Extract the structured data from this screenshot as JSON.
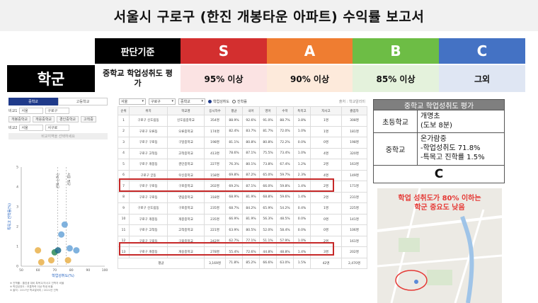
{
  "title": "서울시 구로구 (한진 개봉타운 아파트) 수익률 보고서",
  "criteria": {
    "header_label": "판단기준",
    "grades": [
      {
        "label": "S",
        "color": "#d32f2f",
        "value": "95% 이상",
        "value_bg": "#fbe3e3"
      },
      {
        "label": "A",
        "color": "#ef7d31",
        "value": "90% 이상",
        "value_bg": "#fdeadb"
      },
      {
        "label": "B",
        "color": "#6dbd45",
        "value": "85% 이상",
        "value_bg": "#e4f2dc"
      },
      {
        "label": "C",
        "color": "#4472c4",
        "value": "그외",
        "value_bg": "#dfe6f3"
      }
    ],
    "category": "학군",
    "standard": "중학교 학업성취도 평가"
  },
  "left_panel": {
    "tabs": [
      "중학교",
      "고등학교"
    ],
    "filter1_label": "비교1",
    "filter1_values": [
      "서울",
      "구로구"
    ],
    "chips": [
      "개봉중학교",
      "개웅중학교",
      "경인중학교",
      "고척중"
    ],
    "filter2_label": "비교2",
    "filter2_values": [
      "서울",
      "서구로"
    ],
    "search_placeholder": "비교지역을 선택하세요",
    "scatter": {
      "type": "scatter",
      "xlabel": "학업성취도(%)",
      "ylabel": "특목고 진학률(%)",
      "x_ticks": [
        "50",
        "60",
        "70",
        "80",
        "90",
        "100"
      ],
      "y_ticks": [
        "5",
        "4",
        "3",
        "2",
        "1",
        "0"
      ],
      "ref_labels": [
        "구로구 평균",
        "서울 평균"
      ],
      "points": [
        {
          "x": 60,
          "y": 0.8,
          "c": "#e9b04a"
        },
        {
          "x": 62,
          "y": 0.2,
          "c": "#e9b04a"
        },
        {
          "x": 70,
          "y": 0.7,
          "c": "#2e8b57"
        },
        {
          "x": 72,
          "y": 0.8,
          "c": "#1f6b8a"
        },
        {
          "x": 74,
          "y": 1.6,
          "c": "#6aa5d8"
        },
        {
          "x": 76,
          "y": 2.1,
          "c": "#6aa5d8"
        },
        {
          "x": 78,
          "y": 0.3,
          "c": "#e9b04a"
        },
        {
          "x": 79,
          "y": 0.9,
          "c": "#6aa5d8"
        },
        {
          "x": 83,
          "y": 0.8,
          "c": "#6aa5d8"
        },
        {
          "x": 68,
          "y": 0.3,
          "c": "#e9b04a"
        }
      ],
      "notes": [
        "※ 진학률 : 졸업생 대비 특목고/자사고 진학자 비율",
        "※ 학업성취도 : 보통학력 이상 학생 비율",
        "※ 출처 : 2017년 학교알리미 / 2021년 진학"
      ]
    }
  },
  "mid_panel": {
    "selects": [
      "서울",
      "구로구",
      "중학교"
    ],
    "radio_on": "학업성취도",
    "radio_off": "진학률",
    "source": "출처 : 학교알리미",
    "headers": [
      "순위",
      "위치",
      "학교명",
      "응시자수",
      "평균",
      "국어",
      "영어",
      "수학",
      "특목고",
      "자사고",
      "졸업자"
    ],
    "rows": [
      [
        "1",
        "구로구 신도림동",
        "신도림중학교",
        "354명",
        "88.9%",
        "92.6%",
        "91.0%",
        "88.7%",
        "3.8%",
        "1명",
        "308명"
      ],
      [
        "2",
        "구로구 오류동",
        "오류중학교",
        "174명",
        "82.4%",
        "83.7%",
        "81.7%",
        "72.0%",
        "1.0%",
        "1명",
        "181명"
      ],
      [
        "3",
        "구로구 구로동",
        "구일중학교",
        "198명",
        "81.1%",
        "80.8%",
        "80.8%",
        "72.2%",
        "0.0%",
        "0명",
        "198명"
      ],
      [
        "4",
        "구로구 고척동",
        "고척중학교",
        "413명",
        "78.6%",
        "87.1%",
        "75.5%",
        "73.4%",
        "1.0%",
        "4명",
        "320명"
      ],
      [
        "5",
        "구로구 개봉동",
        "경인중학교",
        "227명",
        "76.3%",
        "80.1%",
        "73.8%",
        "67.4%",
        "1.2%",
        "2명",
        "163명"
      ],
      [
        "6",
        "구로구 궁동",
        "우신중학교",
        "158명",
        "69.8%",
        "87.2%",
        "65.0%",
        "59.7%",
        "2.3%",
        "4명",
        "149명"
      ],
      [
        "7",
        "구로구 구로동",
        "구로중학교",
        "202명",
        "69.2%",
        "87.1%",
        "66.0%",
        "59.8%",
        "1.4%",
        "2명",
        "171명"
      ],
      [
        "8",
        "구로구 구로동",
        "영림중학교",
        "318명",
        "68.9%",
        "81.9%",
        "68.8%",
        "59.6%",
        "1.4%",
        "2명",
        "231명"
      ],
      [
        "9",
        "구로구 신도림동",
        "구로중학교",
        "235명",
        "68.7%",
        "84.2%",
        "65.9%",
        "54.2%",
        "0.4%",
        "1명",
        "225명"
      ],
      [
        "10",
        "구로구 개봉동",
        "개봉중학교",
        "235명",
        "66.9%",
        "81.9%",
        "56.3%",
        "48.5%",
        "0.0%",
        "0명",
        "141명"
      ],
      [
        "11",
        "구로구 고척동",
        "고척중학교",
        "221명",
        "63.9%",
        "80.5%",
        "52.0%",
        "58.4%",
        "0.0%",
        "0명",
        "106명"
      ],
      [
        "12",
        "구로구 구로동",
        "구로중학교",
        "242명",
        "62.7%",
        "77.1%",
        "51.1%",
        "57.9%",
        "1.0%",
        "2명",
        "161명"
      ],
      [
        "13",
        "구로구 개봉동",
        "개웅중학교",
        "278명",
        "55.4%",
        "72.6%",
        "44.8%",
        "48.8%",
        "1.4%",
        "3명",
        "202명"
      ]
    ],
    "footer": [
      "평균",
      "3,169명",
      "71.8%",
      "85.2%",
      "66.6%",
      "63.0%",
      "1.5%",
      "42명",
      "2,470명"
    ]
  },
  "right_panel": {
    "header": "중학교 학업성취도 평가",
    "rows": [
      {
        "key": "초등학교",
        "lines": [
          "개명초",
          "(도보 8분)"
        ]
      },
      {
        "key": "중학교",
        "lines": [
          "온가람중",
          "-학업성취도 71.8%",
          "-특목고 진학률 1.5%"
        ]
      }
    ],
    "grade": "C",
    "map_note_lines": [
      "학업 성취도가 80% 이하는",
      "학군 중요도 낮음"
    ]
  }
}
